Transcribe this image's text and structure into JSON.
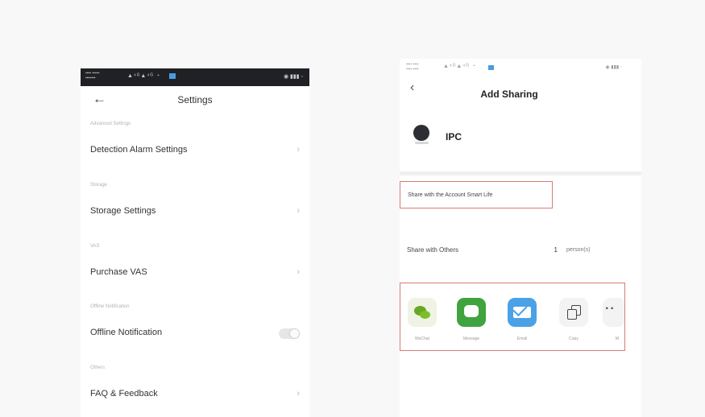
{
  "left": {
    "title": "Settings",
    "sections": [
      {
        "header": "Advanced Settings",
        "label": "Detection Alarm Settings",
        "control": "chevron"
      },
      {
        "header": "Storage",
        "label": "Storage Settings",
        "control": "chevron"
      },
      {
        "header": "VAS",
        "label": "Purchase VAS",
        "control": "chevron"
      },
      {
        "header": "Offline Notification",
        "label": "Offline Notification",
        "control": "toggle",
        "toggle_on": false
      },
      {
        "header": "Others",
        "label": "FAQ & Feedback",
        "control": "chevron"
      }
    ]
  },
  "right": {
    "title": "Add Sharing",
    "device_name": "IPC",
    "share_account_label": "Share with the Account Smart Life",
    "share_others_label": "Share with Others",
    "share_count": "1",
    "persons_unit": "person(s)",
    "apps": [
      {
        "label": "WeChat",
        "icon": "wechat-icon"
      },
      {
        "label": "Message",
        "icon": "message-icon"
      },
      {
        "label": "Email",
        "icon": "email-icon"
      },
      {
        "label": "Copy",
        "icon": "copy-icon"
      },
      {
        "label": "M",
        "icon": "more-icon"
      }
    ]
  },
  "colors": {
    "highlight_border": "#d97c74",
    "wechat_green": "#67a822",
    "message_green": "#41a33f",
    "email_blue": "#4ba1e6"
  }
}
